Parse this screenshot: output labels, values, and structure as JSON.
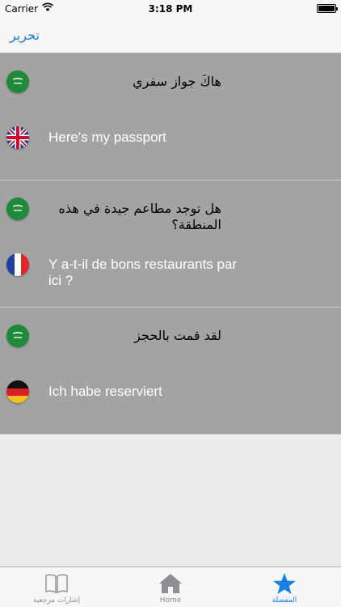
{
  "status_bar": {
    "carrier": "Carrier",
    "time": "3:18 PM"
  },
  "nav_bar": {
    "edit_label": "تحرير"
  },
  "phrases": [
    {
      "arabic": "هاكَ جواز سفري",
      "translation": "Here's my passport",
      "translation_flag": "uk-flag-icon"
    },
    {
      "arabic": "هل توجد مطاعم جيدة في هذه المنطقة؟",
      "translation": "Y a-t-il de bons restaurants par ici ?",
      "translation_flag": "france-flag-icon"
    },
    {
      "arabic": "لقد قمت بالحجز",
      "translation": "Ich habe reserviert",
      "translation_flag": "germany-flag-icon"
    }
  ],
  "tab_bar": {
    "tabs": [
      {
        "label": "إشارات مرجعية",
        "icon": "book-icon"
      },
      {
        "label": "Home",
        "icon": "home-icon"
      },
      {
        "label": "المفضلة",
        "icon": "star-icon",
        "active": true
      }
    ]
  },
  "colors": {
    "accent": "#1a7de6",
    "row_background": "#a3a3a3"
  }
}
